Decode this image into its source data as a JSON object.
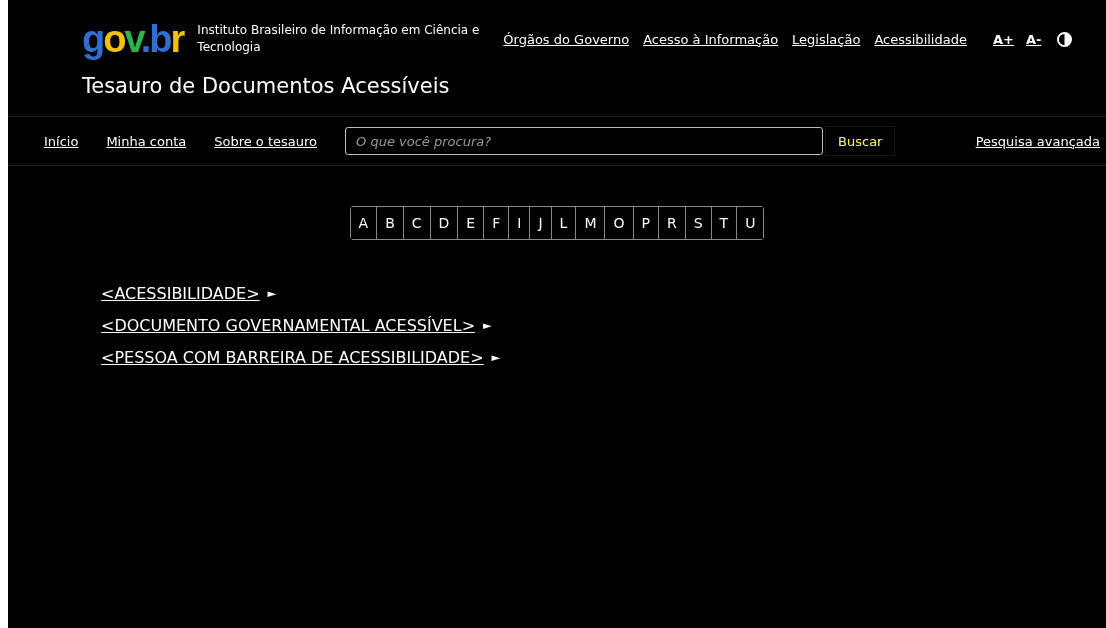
{
  "header": {
    "logo": "gov.br",
    "institute": "Instituto Brasileiro de Informação em Ciência e Tecnologia",
    "links": [
      "Órgãos do Governo",
      "Acesso à Informação",
      "Legislação",
      "Acessibilidade"
    ],
    "font_buttons": [
      "A+",
      "A-"
    ],
    "title": "Tesauro de Documentos Acessíveis"
  },
  "nav": {
    "links": [
      "Início",
      "Minha conta",
      "Sobre o tesauro"
    ],
    "search": {
      "placeholder": "O que você procura?",
      "button": "Buscar"
    },
    "advanced": "Pesquisa avançada"
  },
  "letters": [
    "A",
    "B",
    "C",
    "D",
    "E",
    "F",
    "I",
    "J",
    "L",
    "M",
    "O",
    "P",
    "R",
    "S",
    "T",
    "U"
  ],
  "terms": [
    {
      "label": "<ACESSIBILIDADE>",
      "expand": "►"
    },
    {
      "label": "<DOCUMENTO GOVERNAMENTAL ACESSÍVEL>",
      "expand": "►"
    },
    {
      "label": "<PESSOA COM BARREIRA DE ACESSIBILIDADE>",
      "expand": "►"
    }
  ]
}
